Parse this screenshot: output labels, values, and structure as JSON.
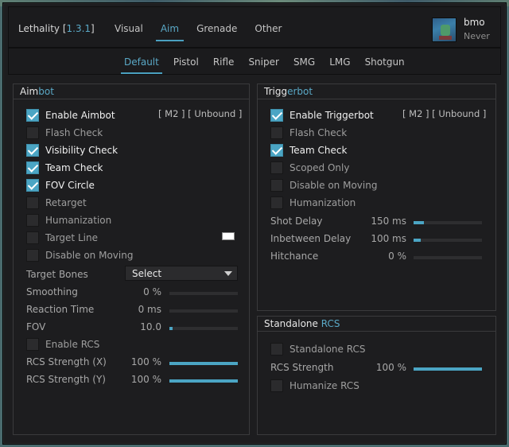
{
  "brand": {
    "name": "Lethality",
    "version": "1.3.1"
  },
  "tabs": [
    "Visual",
    "Aim",
    "Grenade",
    "Other"
  ],
  "user": {
    "name": "bmo",
    "status": "Never"
  },
  "subtabs": [
    "Default",
    "Pistol",
    "Rifle",
    "Sniper",
    "SMG",
    "LMG",
    "Shotgun"
  ],
  "aimbot": {
    "title_a": "Aim",
    "title_b": "bot",
    "keybind": "[ M2 ]  [ Unbound ]",
    "checks": [
      {
        "label": "Enable Aimbot",
        "checked": true
      },
      {
        "label": "Flash Check",
        "checked": false
      },
      {
        "label": "Visibility Check",
        "checked": true
      },
      {
        "label": "Team Check",
        "checked": true
      },
      {
        "label": "FOV Circle",
        "checked": true
      },
      {
        "label": "Retarget",
        "checked": false
      },
      {
        "label": "Humanization",
        "checked": false
      },
      {
        "label": "Target Line",
        "checked": false
      },
      {
        "label": "Disable on Moving",
        "checked": false
      }
    ],
    "target_bones_label": "Target Bones",
    "target_bones_value": "Select",
    "sliders": [
      {
        "label": "Smoothing",
        "value": "0 %",
        "fraction": 0
      },
      {
        "label": "Reaction Time",
        "value": "0 ms",
        "fraction": 0
      },
      {
        "label": "FOV",
        "value": "10.0",
        "fraction": 0.04
      }
    ],
    "rcs_check": {
      "label": "Enable RCS",
      "checked": false
    },
    "rcs_sliders": [
      {
        "label": "RCS Strength (X)",
        "value": "100 %",
        "fraction": 1
      },
      {
        "label": "RCS Strength (Y)",
        "value": "100 %",
        "fraction": 1
      }
    ]
  },
  "trigger": {
    "title_a": "Trigg",
    "title_b": "erbot",
    "keybind": "[ M2 ]  [ Unbound ]",
    "checks": [
      {
        "label": "Enable Triggerbot",
        "checked": true
      },
      {
        "label": "Flash Check",
        "checked": false
      },
      {
        "label": "Team Check",
        "checked": true
      },
      {
        "label": "Scoped Only",
        "checked": false
      },
      {
        "label": "Disable on Moving",
        "checked": false
      },
      {
        "label": "Humanization",
        "checked": false
      }
    ],
    "sliders": [
      {
        "label": "Shot Delay",
        "value": "150 ms",
        "fraction": 0.15
      },
      {
        "label": "Inbetween Delay",
        "value": "100 ms",
        "fraction": 0.1
      },
      {
        "label": "Hitchance",
        "value": "0 %",
        "fraction": 0
      }
    ]
  },
  "standalone": {
    "title_a": "Standalone ",
    "title_b": "RCS",
    "check1": {
      "label": "Standalone RCS",
      "checked": false
    },
    "slider": {
      "label": "RCS Strength",
      "value": "100 %",
      "fraction": 1
    },
    "check2": {
      "label": "Humanize RCS",
      "checked": false
    }
  },
  "colors": {
    "accent": "#4ba5c4",
    "bg": "#1d1d1f"
  }
}
